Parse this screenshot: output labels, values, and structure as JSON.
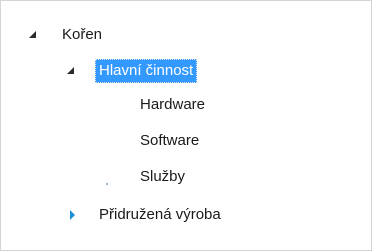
{
  "tree": {
    "root": {
      "label": "Kořen",
      "expanded": true
    },
    "main_activity": {
      "label": "Hlavní činnost",
      "expanded": true,
      "selected": true
    },
    "children": [
      {
        "label": "Hardware"
      },
      {
        "label": "Software"
      },
      {
        "label": "Služby"
      }
    ],
    "associated": {
      "label": "Přidružená výroba",
      "expanded": false
    }
  },
  "colors": {
    "selection_bg": "#3399ff",
    "selection_text": "#ffffff",
    "expanded_glyph": "#2b2b2b",
    "collapsed_glyph": "#1e8fd6"
  }
}
